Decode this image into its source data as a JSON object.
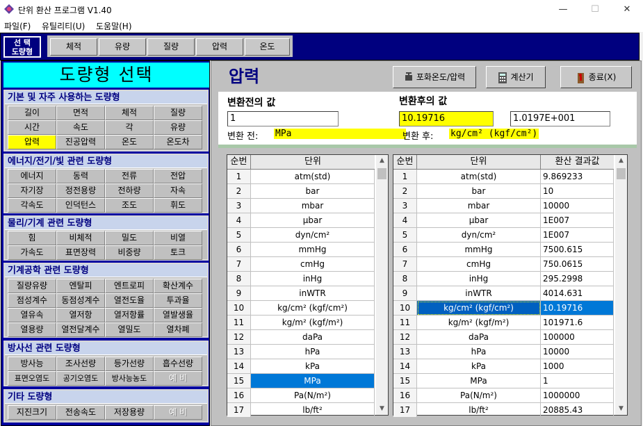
{
  "window": {
    "title": "단위 환산 프로그램 V1.40",
    "controls": [
      "—",
      "☐",
      "✕"
    ]
  },
  "menu": [
    "파일(F)",
    "유틸리티(U)",
    "도움말(H)"
  ],
  "topbar": {
    "select_label_1": "선  택",
    "select_label_2": "도량형",
    "categories": [
      "체적",
      "유량",
      "질량",
      "압력",
      "온도"
    ]
  },
  "left": {
    "title": "도량형 선택",
    "groups": [
      {
        "title": "기본 및 자주 사용하는 도량형",
        "items": [
          "길이",
          "면적",
          "체적",
          "질량",
          "시간",
          "속도",
          "각",
          "유량",
          "압력",
          "진공압력",
          "온도",
          "온도차"
        ]
      },
      {
        "title": "에너지/전기/빛 관련 도량형",
        "items": [
          "에너지",
          "동력",
          "전류",
          "전압",
          "자기장",
          "정전용량",
          "전하량",
          "자속",
          "각속도",
          "인덕턴스",
          "조도",
          "휘도"
        ]
      },
      {
        "title": "물리/기계 관련 도량형",
        "items": [
          "힘",
          "비체적",
          "밀도",
          "비열",
          "가속도",
          "표면장력",
          "비중량",
          "토크"
        ]
      },
      {
        "title": "기계공학 관련 도량형",
        "items": [
          "질량유량",
          "엔탈피",
          "엔트로피",
          "확산계수",
          "점성계수",
          "동점성계수",
          "열전도율",
          "투과율",
          "열유속",
          "열저항",
          "열저항률",
          "열발생율",
          "열용량",
          "열전달계수",
          "열밀도",
          "열차폐"
        ]
      },
      {
        "title": "방사선 관련 도량형",
        "items": [
          "방사능",
          "조사선량",
          "등가선량",
          "흡수선량",
          "표면오염도",
          "공기오염도",
          "방사능농도",
          "예 비"
        ]
      },
      {
        "title": "기타 도량형",
        "items": [
          "지진크기",
          "전송속도",
          "저장용량",
          "예 비"
        ]
      }
    ]
  },
  "right": {
    "unit_title": "압력",
    "buttons": {
      "saturation": "포화온도/압력",
      "calculator": "계산기",
      "exit": "종료(X)"
    },
    "before_label": "변환전의 값",
    "after_label": "변환후의 값",
    "before_value": "1",
    "after_value": "10.19716",
    "after_value_exp": "1.0197E+001",
    "from_label": "변환 전:",
    "from_unit": "MPa",
    "to_label": "변환 후:",
    "to_unit": "kg/cm² (kgf/cm²)"
  },
  "table_left": {
    "headers": [
      "순번",
      "단위"
    ],
    "rows": [
      [
        "1",
        "atm(std)"
      ],
      [
        "2",
        "bar"
      ],
      [
        "3",
        "mbar"
      ],
      [
        "4",
        "μbar"
      ],
      [
        "5",
        "dyn/cm²"
      ],
      [
        "6",
        "mmHg"
      ],
      [
        "7",
        "cmHg"
      ],
      [
        "8",
        "inHg"
      ],
      [
        "9",
        "inWTR"
      ],
      [
        "10",
        "kg/cm² (kgf/cm²)"
      ],
      [
        "11",
        "kg/m² (kgf/m²)"
      ],
      [
        "12",
        "daPa"
      ],
      [
        "13",
        "hPa"
      ],
      [
        "14",
        "kPa"
      ],
      [
        "15",
        "MPa"
      ],
      [
        "16",
        "Pa(N/m²)"
      ],
      [
        "17",
        "lb/ft²"
      ]
    ]
  },
  "table_right": {
    "headers": [
      "순번",
      "단위",
      "환산 결과값"
    ],
    "rows": [
      [
        "1",
        "atm(std)",
        "9.869233"
      ],
      [
        "2",
        "bar",
        "10"
      ],
      [
        "3",
        "mbar",
        "10000"
      ],
      [
        "4",
        "μbar",
        "1E007"
      ],
      [
        "5",
        "dyn/cm²",
        "1E007"
      ],
      [
        "6",
        "mmHg",
        "7500.615"
      ],
      [
        "7",
        "cmHg",
        "750.0615"
      ],
      [
        "8",
        "inHg",
        "295.2998"
      ],
      [
        "9",
        "inWTR",
        "4014.631"
      ],
      [
        "10",
        "kg/cm² (kgf/cm²)",
        "10.19716"
      ],
      [
        "11",
        "kg/m² (kgf/m²)",
        "101971.6"
      ],
      [
        "12",
        "daPa",
        "100000"
      ],
      [
        "13",
        "hPa",
        "10000"
      ],
      [
        "14",
        "kPa",
        "1000"
      ],
      [
        "15",
        "MPa",
        "1"
      ],
      [
        "16",
        "Pa(N/m²)",
        "1000000"
      ],
      [
        "17",
        "lb/ft²",
        "20885.43"
      ]
    ]
  },
  "colors": {
    "accent_blue": "#0078d7",
    "navy": "#00007f",
    "cyan": "#00ffff",
    "selected": "#ffff00"
  }
}
